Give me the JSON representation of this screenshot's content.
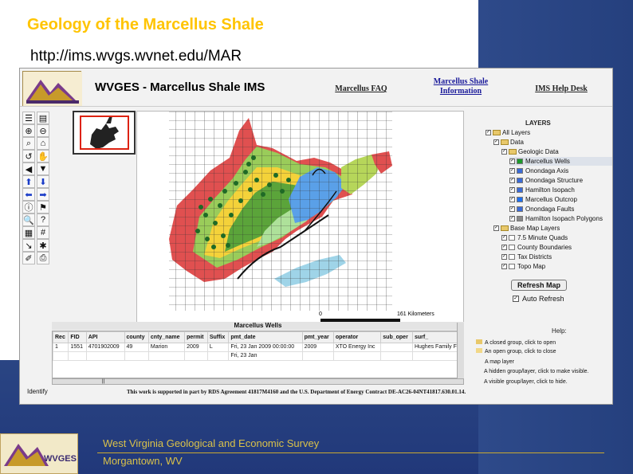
{
  "slide": {
    "title": "Geology of the Marcellus Shale",
    "url": "http://ims.wvgs.wvnet.edu/MAR",
    "footer_org": "West Virginia Geological and Economic Survey",
    "footer_city": "Morgantown, WV",
    "logo_text": "WVGES"
  },
  "app": {
    "title": "WVGES - Marcellus Shale IMS",
    "links": [
      "Marcellus FAQ",
      "Marcellus Shale Information",
      "IMS Help Desk"
    ],
    "scale_min": "0",
    "scale_max": "161 Kilometers"
  },
  "layers": {
    "header": "LAYERS",
    "items": [
      {
        "label": "All Layers",
        "level": 0,
        "type": "folder"
      },
      {
        "label": "Data",
        "level": 1,
        "type": "folder"
      },
      {
        "label": "Geologic Data",
        "level": 2,
        "type": "folder"
      },
      {
        "label": "Marcellus Wells",
        "level": 3,
        "type": "layer",
        "swatch": "#1c9a2c",
        "selected": true
      },
      {
        "label": "Onondaga Axis",
        "level": 3,
        "type": "layer",
        "swatch": "#3b6bd6"
      },
      {
        "label": "Onondaga Structure",
        "level": 3,
        "type": "layer",
        "swatch": "#3b6bd6"
      },
      {
        "label": "Hamilton Isopach",
        "level": 3,
        "type": "layer",
        "swatch": "#3b6bd6"
      },
      {
        "label": "Marcellus Outcrop",
        "level": 3,
        "type": "layer",
        "swatch": "#1e6ff0"
      },
      {
        "label": "Onondaga Faults",
        "level": 3,
        "type": "layer",
        "swatch": "#3b6bd6"
      },
      {
        "label": "Hamilton Isopach Polygons",
        "level": 3,
        "type": "layer",
        "swatch": "#888"
      },
      {
        "label": "Base Map Layers",
        "level": 1,
        "type": "folder"
      },
      {
        "label": "7.5 Minute Quads",
        "level": 2,
        "type": "layer",
        "swatch": "#ffffff"
      },
      {
        "label": "County Boundaries",
        "level": 2,
        "type": "layer",
        "swatch": "#ffffff"
      },
      {
        "label": "Tax Districts",
        "level": 2,
        "type": "layer",
        "swatch": "#ffffff"
      },
      {
        "label": "Topo Map",
        "level": 2,
        "type": "layer",
        "swatch": "#ffffff"
      }
    ],
    "refresh_label": "Refresh Map",
    "auto_refresh_label": "Auto Refresh"
  },
  "wells": {
    "title": "Marcellus Wells",
    "columns": [
      "Rec",
      "FID",
      "API",
      "county",
      "cnty_name",
      "permit",
      "Suffix",
      "pmt_date",
      "pmt_year",
      "operator",
      "sub_oper",
      "surf_"
    ],
    "rows": [
      [
        "1",
        "1551",
        "4701902009",
        "49",
        "Marion",
        "2009",
        "L",
        "Fri, 23 Jan 2009 00:00:00",
        "2009",
        "XTO Energy Inc",
        "",
        "Hughes Family F"
      ],
      [
        "",
        "",
        "",
        "",
        "",
        "",
        "",
        "Fri, 23 Jan",
        "",
        "",
        "",
        ""
      ]
    ]
  },
  "help": {
    "title": "Help:",
    "items": [
      "A closed group, click to open",
      "An open group, click to close",
      "A map layer",
      "A hidden group/layer, click to make visible.",
      "A visible group/layer, click to hide."
    ]
  },
  "footer": {
    "identify": "Identify",
    "note": "This work is supported in part by RDS Agreement 41817M4160 and the U.S. Department of Energy Contract DE-AC26-04NT41817.630.01.14."
  }
}
